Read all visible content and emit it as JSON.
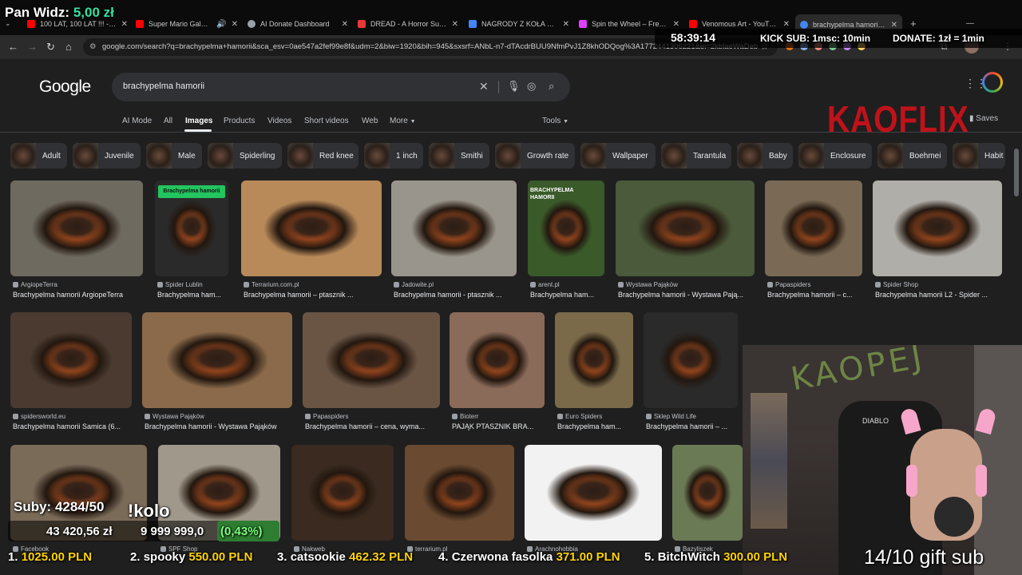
{
  "browser": {
    "tabs": [
      {
        "title": "100 LAT, 100 LAT !!! - You",
        "color": "#ff0000"
      },
      {
        "title": "Super Mario Galaxy M",
        "color": "#ff0000"
      },
      {
        "title": "AI Donate Dashboard",
        "color": "#9aa0a6"
      },
      {
        "title": "DREAD - A Horror Surviv",
        "color": "#e53935"
      },
      {
        "title": "NAGRODY Z KOŁA DO ZR",
        "color": "#4285f4"
      },
      {
        "title": "Spin the Wheel – Free W",
        "color": "#e040fb"
      },
      {
        "title": "Venomous Art - YouTube",
        "color": "#ff0000"
      },
      {
        "title": "brachypelma hamorii - G",
        "color": "#4285f4"
      }
    ],
    "url": "google.com/search?q=brachypelma+hamorii&sca_esv=0ae547a2fef99e8f&udm=2&biw=1920&bih=945&sxsrf=ANbL-n7-dTAcdrBUU9NfmPvJ1Z8khODQog%3A1772441306221&ei=2kblaeWaDeb",
    "saves": "Saves"
  },
  "search": {
    "logo": "Google",
    "query": "brachypelma hamorii",
    "tabs": [
      "AI Mode",
      "All",
      "Images",
      "Products",
      "Videos",
      "Short videos",
      "Web",
      "More"
    ],
    "tools": "Tools",
    "chips": [
      "Adult",
      "Juvenile",
      "Male",
      "Spiderling",
      "Red knee",
      "1 inch",
      "Smithi",
      "Growth rate",
      "Wallpaper",
      "Tarantula",
      "Baby",
      "Enclosure",
      "Boehmei",
      "Habit"
    ]
  },
  "results": {
    "row1": [
      {
        "source": "ArgiopeTerra",
        "caption": "Brachypelma hamorii ArgiopeTerra"
      },
      {
        "source": "Spider Lublin",
        "caption": "Brachypelma ham..."
      },
      {
        "source": "Terrarium.com.pl",
        "caption": "Brachypelma hamorii – ptasznik ..."
      },
      {
        "source": "Jadowite.pl",
        "caption": "Brachypelma hamorii - ptasznik ..."
      },
      {
        "source": "arent.pl",
        "caption": "Brachypelma ham..."
      },
      {
        "source": "Wystawa Pająków",
        "caption": "Brachypelma hamorii - Wystawa Pają..."
      },
      {
        "source": "Papaspiders",
        "caption": "Brachypelma hamorii – c..."
      },
      {
        "source": "Spider Shop",
        "caption": "Brachypelma hamorii L2 - Spider ..."
      }
    ],
    "row2": [
      {
        "source": "spidersworld.eu",
        "caption": "Brachypelma hamorii Samica (6..."
      },
      {
        "source": "Wystawa Pająków",
        "caption": "Brachypelma hamorii - Wystawa Pająków"
      },
      {
        "source": "Papaspiders",
        "caption": "Brachypelma hamorii – cena, wyma..."
      },
      {
        "source": "Bioterr",
        "caption": "PAJĄK PTASZNIK BRA..."
      },
      {
        "source": "Euro Spiders",
        "caption": "Brachypelma ham..."
      },
      {
        "source": "Sklep Wild Life",
        "caption": "Brachypelma hamorii – ..."
      }
    ],
    "row3": [
      {
        "source": "Facebook"
      },
      {
        "source": "SPF Shop"
      },
      {
        "source": "Nakweb"
      },
      {
        "source": "terrarium.pl"
      },
      {
        "source": "Arachnohobbia"
      },
      {
        "source": "Bazyliszek"
      }
    ],
    "thumb_labels": {
      "lublin": "Brachypelma hamorii",
      "arent": "BRACHYPELMA HAMORII"
    }
  },
  "stream": {
    "pan_widz_label": "Pan Widz:",
    "pan_widz_value": "5,00 zł",
    "timer": "58:39:14",
    "kick_sub": "KICK SUB: 1msc: 10min",
    "donate": "DONATE: 1zł = 1min",
    "channel_logo": "KAOFLIX",
    "subs": "Suby: 4284/50",
    "kolo": "!kolo",
    "goal_current": "43 420,56 zł",
    "goal_target": "9 999 999,0",
    "goal_percent": "(0,43%)",
    "leaderboard": [
      {
        "rank": "1.",
        "name": "",
        "amount": "1025.00 PLN"
      },
      {
        "rank": "2.",
        "name": "spooky",
        "amount": "550.00 PLN"
      },
      {
        "rank": "3.",
        "name": "catsookie",
        "amount": "462.32 PLN"
      },
      {
        "rank": "4.",
        "name": "Czerwona fasolka",
        "amount": "371.00 PLN"
      },
      {
        "rank": "5.",
        "name": "BitchWitch",
        "amount": "300.00 PLN"
      }
    ],
    "gift_sub": "14/10 gift sub",
    "wall_text": "KAOPEJ",
    "chair_text": "DIABLO"
  }
}
